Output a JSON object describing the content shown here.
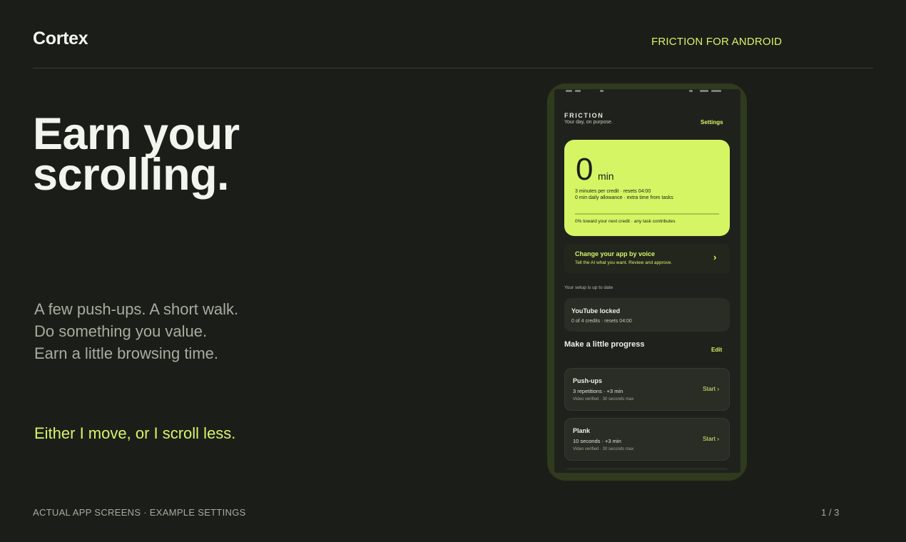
{
  "header": {
    "brand": "Cortex",
    "nav_link": "FRICTION FOR ANDROID"
  },
  "hero": {
    "headline_line1": "Earn your",
    "headline_line2": "scrolling.",
    "lede_line1": "A few push-ups. A short walk.",
    "lede_line2": "Do something you value.",
    "lede_line3": "Earn a little browsing time.",
    "tagline": "Either I move, or I scroll less."
  },
  "footer": {
    "caption": "ACTUAL APP SCREENS · EXAMPLE SETTINGS",
    "pager": "1 / 3"
  },
  "phone": {
    "app_name": "FRICTION",
    "app_subtitle": "Your day, on purpose.",
    "settings_label": "Settings",
    "credit_card": {
      "minutes_value": "0",
      "minutes_unit": "min",
      "line1": "3 minutes per credit · resets 04:00",
      "line2": "0 min daily allowance · extra time from tasks",
      "progress_percent": 0,
      "progress_text": "0% toward your next credit · any task contributes"
    },
    "voice_card": {
      "title": "Change your app by voice",
      "subtitle": "Tell the AI what you want. Review and approve."
    },
    "setup_status": "Your setup is up to date",
    "lock_card": {
      "title": "YouTube locked",
      "detail": "0 of 4 credits · resets 04:00"
    },
    "progress_heading": "Make a little progress",
    "edit_label": "Edit",
    "tasks": [
      {
        "name": "Push-ups",
        "detail": "3 repetitions · +3 min",
        "verify": "Video verified · 30 seconds max",
        "action": "Start ›"
      },
      {
        "name": "Plank",
        "detail": "10 seconds · +3 min",
        "verify": "Video verified · 30 seconds max",
        "action": "Start ›"
      }
    ]
  },
  "colors": {
    "background": "#1b1e18",
    "accent": "#d6f56a",
    "card": "#2a2d26",
    "credit_card": "#d5f564",
    "phone_frame": "#2f3a1e"
  }
}
